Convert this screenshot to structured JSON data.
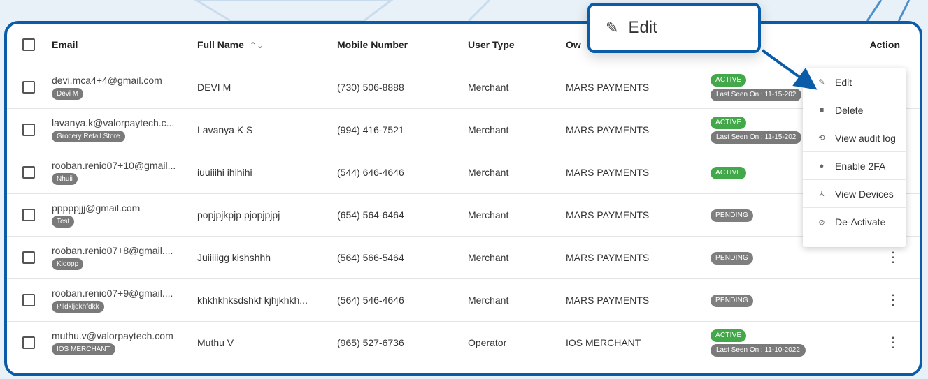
{
  "header": {
    "email": "Email",
    "full_name": "Full Name",
    "mobile": "Mobile Number",
    "user_type": "User Type",
    "owner": "Ow",
    "action": "Action"
  },
  "rows": [
    {
      "email": "devi.mca4+4@gmail.com",
      "tag": "Devi M",
      "name": "DEVI M",
      "mobile": "(730) 506-8888",
      "type": "Merchant",
      "owner": "MARS PAYMENTS",
      "status": "ACTIVE",
      "seen": "Last Seen On : 11-15-202"
    },
    {
      "email": "lavanya.k@valorpaytech.c...",
      "tag": "Grocery Retail Store",
      "name": "Lavanya K S",
      "mobile": "(994) 416-7521",
      "type": "Merchant",
      "owner": "MARS PAYMENTS",
      "status": "ACTIVE",
      "seen": "Last Seen On : 11-15-202"
    },
    {
      "email": "rooban.renio07+10@gmail...",
      "tag": "Nhuii",
      "name": "iuuiiihi ihihihi",
      "mobile": "(544) 646-4646",
      "type": "Merchant",
      "owner": "MARS PAYMENTS",
      "status": "ACTIVE",
      "seen": ""
    },
    {
      "email": "pppppjjj@gmail.com",
      "tag": "Test",
      "name": "popjpjkpjp pjopjpjpj",
      "mobile": "(654) 564-6464",
      "type": "Merchant",
      "owner": "MARS PAYMENTS",
      "status": "PENDING",
      "seen": ""
    },
    {
      "email": "rooban.renio07+8@gmail....",
      "tag": "Kioopp",
      "name": "Juiiiiigg kishshhh",
      "mobile": "(564) 566-5464",
      "type": "Merchant",
      "owner": "MARS PAYMENTS",
      "status": "PENDING",
      "seen": ""
    },
    {
      "email": "rooban.renio07+9@gmail....",
      "tag": "Plldkljdkhfdkk",
      "name": "khkhkhksdshkf kjhjkhkh...",
      "mobile": "(564) 546-4646",
      "type": "Merchant",
      "owner": "MARS PAYMENTS",
      "status": "PENDING",
      "seen": ""
    },
    {
      "email": "muthu.v@valorpaytech.com",
      "tag": "IOS MERCHANT",
      "name": "Muthu V",
      "mobile": "(965) 527-6736",
      "type": "Operator",
      "owner": "IOS MERCHANT",
      "status": "ACTIVE",
      "seen": "Last Seen On : 11-10-2022"
    }
  ],
  "menu": [
    {
      "label": "Edit",
      "icon": "pencil-icon"
    },
    {
      "label": "Delete",
      "icon": "trash-icon"
    },
    {
      "label": "View audit log",
      "icon": "history-icon"
    },
    {
      "label": "Enable 2FA",
      "icon": "check-circle-icon"
    },
    {
      "label": "View Devices",
      "icon": "devices-icon"
    },
    {
      "label": "De-Activate",
      "icon": "block-icon"
    }
  ],
  "callout": {
    "label": "Edit",
    "icon": "pencil-icon"
  },
  "colors": {
    "accent": "#0a5ca8",
    "active": "#43a84a",
    "pending": "#7f7f7f"
  }
}
